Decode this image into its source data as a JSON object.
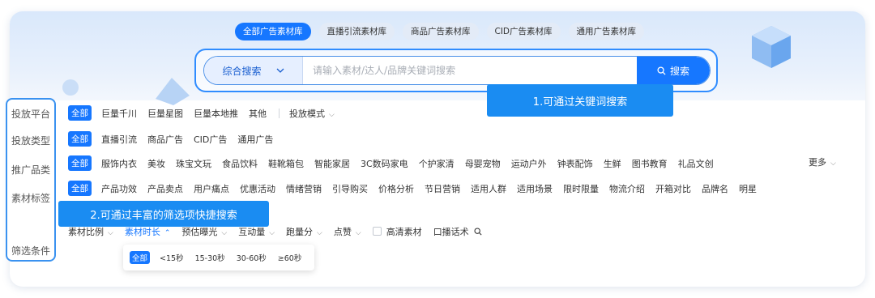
{
  "library_tabs": [
    "全部广告素材库",
    "直播引流素材库",
    "商品广告素材库",
    "CID广告素材库",
    "通用广告素材库"
  ],
  "search": {
    "type_label": "综合搜索",
    "placeholder": "请输入素材/达人/品牌关键词搜索",
    "button_label": "搜索"
  },
  "callouts": {
    "first": "1.可通过关键词搜索",
    "second": "2.可通过丰富的筛选项快捷搜索"
  },
  "sidebar": [
    "投放平台",
    "投放类型",
    "推广品类",
    "素材标签",
    "筛选条件"
  ],
  "filters": {
    "all_label": "全部",
    "platform": [
      "巨量千川",
      "巨量星图",
      "巨量本地推",
      "其他"
    ],
    "platform_mode": "投放模式",
    "type": [
      "直播引流",
      "商品广告",
      "CID广告",
      "通用广告"
    ],
    "category": [
      "服饰内衣",
      "美妆",
      "珠宝文玩",
      "食品饮料",
      "鞋靴箱包",
      "智能家居",
      "3C数码家电",
      "个护家清",
      "母婴宠物",
      "运动户外",
      "钟表配饰",
      "生鲜",
      "图书教育",
      "礼品文创"
    ],
    "more_label": "更多",
    "tags": [
      "产品功效",
      "产品卖点",
      "用户痛点",
      "优惠活动",
      "情绪营销",
      "引导购买",
      "价格分析",
      "节日营销",
      "适用人群",
      "适用场景",
      "限时限量",
      "物流介绍",
      "开箱对比",
      "品牌名",
      "明星"
    ]
  },
  "conditions": {
    "dropdowns": [
      "素材比例",
      "素材时长",
      "预估曝光",
      "互动量",
      "跑量分",
      "点赞"
    ],
    "hd_label": "高清素材",
    "script_label": "口播话术"
  },
  "duration_options": [
    "全部",
    "<15秒",
    "15-30秒",
    "30-60秒",
    "≥60秒"
  ],
  "colors": {
    "accent": "#1677ff",
    "callout": "#1a8cf2",
    "outline": "#3a92f0"
  }
}
